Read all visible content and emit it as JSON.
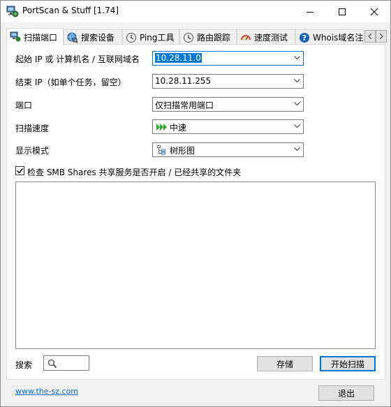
{
  "window": {
    "title": "PortScan & Stuff [1.74]"
  },
  "tabs": [
    {
      "label": "扫描端口",
      "icon": "network-computer-icon",
      "active": true
    },
    {
      "label": "搜索设备",
      "icon": "globe-search-icon",
      "active": false
    },
    {
      "label": "Ping工具",
      "icon": "clock-ping-icon",
      "active": false
    },
    {
      "label": "路由跟踪",
      "icon": "clock-trace-icon",
      "active": false
    },
    {
      "label": "速度测试",
      "icon": "speedometer-icon",
      "active": false
    },
    {
      "label": "Whois域名注",
      "icon": "question-icon",
      "active": false
    }
  ],
  "form": {
    "start_ip": {
      "label": "起始 IP 或 计算机名 / 互联网域名",
      "value": "10.28.11.0"
    },
    "end_ip": {
      "label": "结束 IP（如单个任务，留空）",
      "value": "10.28.11.255"
    },
    "port": {
      "label": "端口",
      "value": "仅扫描常用端口"
    },
    "speed": {
      "label": "扫描速度",
      "value": "中速",
      "icon": "fast-forward-icon"
    },
    "display_mode": {
      "label": "显示模式",
      "value": "树形图",
      "icon": "tree-view-icon"
    },
    "smb_check": {
      "label": "检查 SMB Shares 共享服务是否开启 / 已经共享的文件夹",
      "checked": true
    }
  },
  "bottom": {
    "search_label": "搜索",
    "save_label": "存储",
    "start_label": "开始扫描",
    "website": "www.the-sz.com",
    "exit_label": "退出"
  },
  "colors": {
    "accent": "#0078d7",
    "link": "#0066cc",
    "speed_icon": "#22aa22"
  }
}
